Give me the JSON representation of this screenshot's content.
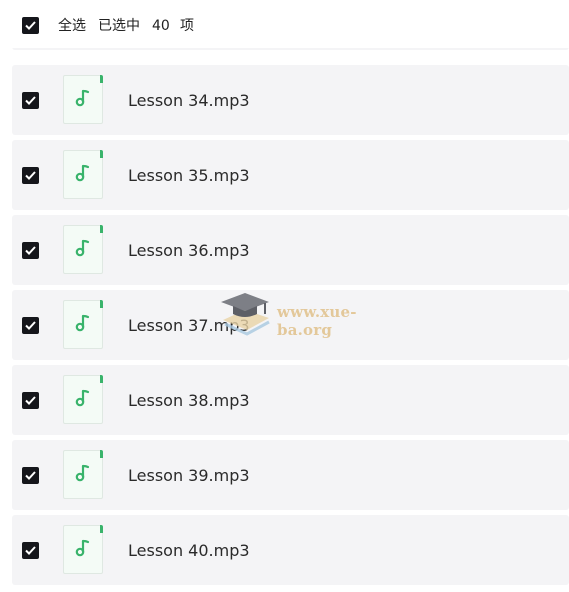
{
  "header": {
    "select_all_label": "全选",
    "selected_label": "已选中",
    "selected_count": "40",
    "unit_label": "项",
    "all_checked": true
  },
  "files": [
    {
      "name": "",
      "checked": true,
      "icon": "music-note-icon"
    },
    {
      "name": "Lesson 34.mp3",
      "checked": true,
      "icon": "music-note-icon"
    },
    {
      "name": "Lesson 35.mp3",
      "checked": true,
      "icon": "music-note-icon"
    },
    {
      "name": "Lesson 36.mp3",
      "checked": true,
      "icon": "music-note-icon"
    },
    {
      "name": "Lesson 37.mp3",
      "checked": true,
      "icon": "music-note-icon"
    },
    {
      "name": "Lesson 38.mp3",
      "checked": true,
      "icon": "music-note-icon"
    },
    {
      "name": "Lesson 39.mp3",
      "checked": true,
      "icon": "music-note-icon"
    },
    {
      "name": "Lesson 40.mp3",
      "checked": true,
      "icon": "music-note-icon"
    }
  ],
  "watermark": {
    "text": "www.xue-ba.org",
    "icon": "graduation-cap-icon"
  },
  "colors": {
    "accent_green": "#39b36b",
    "checkbox": "#15161b",
    "row_bg": "#f4f4f6"
  }
}
